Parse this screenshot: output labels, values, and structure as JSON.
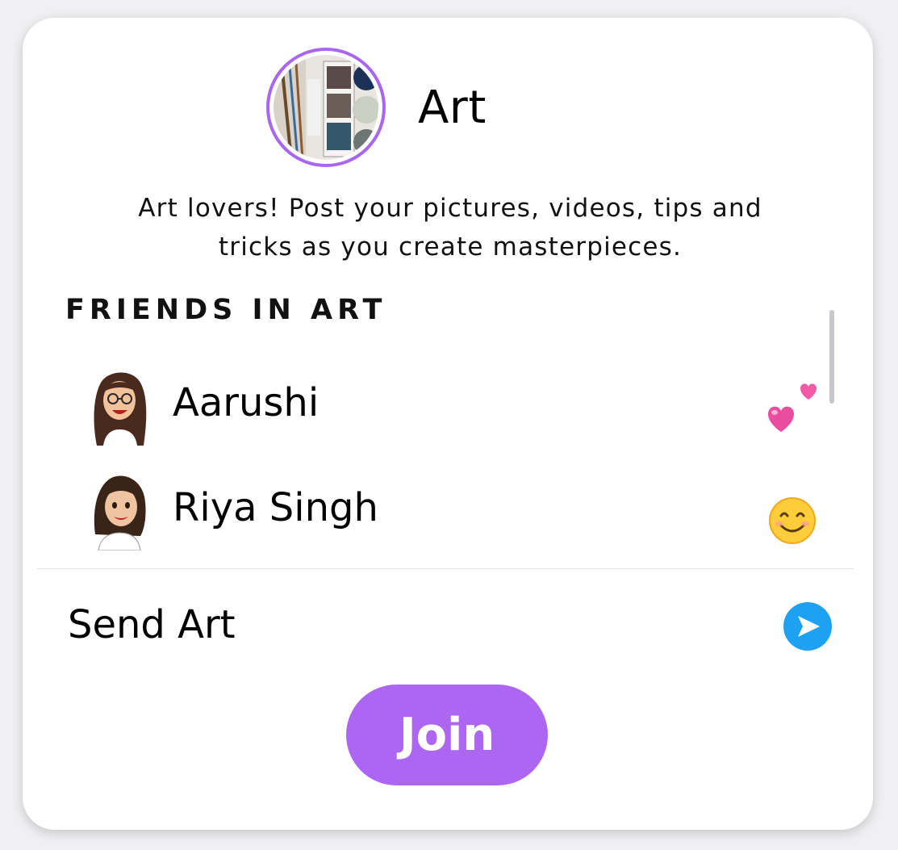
{
  "group": {
    "title": "Art",
    "description": "Art lovers! Post your pictures, videos, tips and tricks as you create masterpieces."
  },
  "friends_section": {
    "heading": "FRIENDS IN ART",
    "friends": [
      {
        "name": "Aarushi",
        "emoji": "two-hearts-icon"
      },
      {
        "name": "Riya Singh",
        "emoji": "smiling-face-icon"
      }
    ]
  },
  "send": {
    "label": "Send Art",
    "icon": "send-arrow-icon"
  },
  "join": {
    "label": "Join"
  },
  "colors": {
    "accent": "#ac66f1",
    "send_icon": "#1da1f2",
    "heart": "#ea4d9f"
  }
}
